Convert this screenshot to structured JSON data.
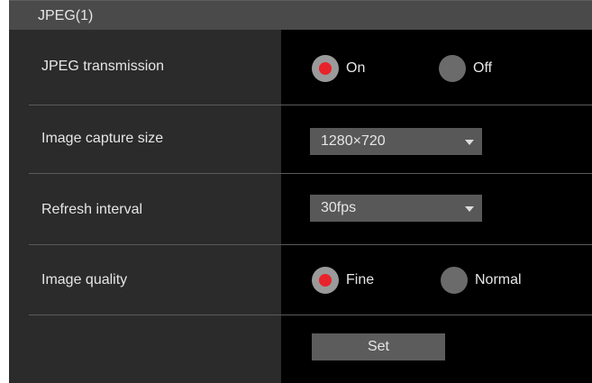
{
  "section": {
    "title": "JPEG(1)"
  },
  "rows": {
    "jpeg_transmission": {
      "label": "JPEG transmission",
      "options": [
        "On",
        "Off"
      ],
      "selected": "On"
    },
    "image_capture_size": {
      "label": "Image capture size",
      "value": "1280×720"
    },
    "refresh_interval": {
      "label": "Refresh interval",
      "value": "30fps"
    },
    "image_quality": {
      "label": "Image quality",
      "options": [
        "Fine",
        "Normal"
      ],
      "selected": "Fine"
    }
  },
  "buttons": {
    "set_label": "Set"
  },
  "colors": {
    "radio_selected": "#e8232b",
    "label_column": "#2b2b2b",
    "control_column": "#000000",
    "header": "#4a4a4a"
  },
  "icons": {
    "dropdown": "chevron-down-icon"
  }
}
